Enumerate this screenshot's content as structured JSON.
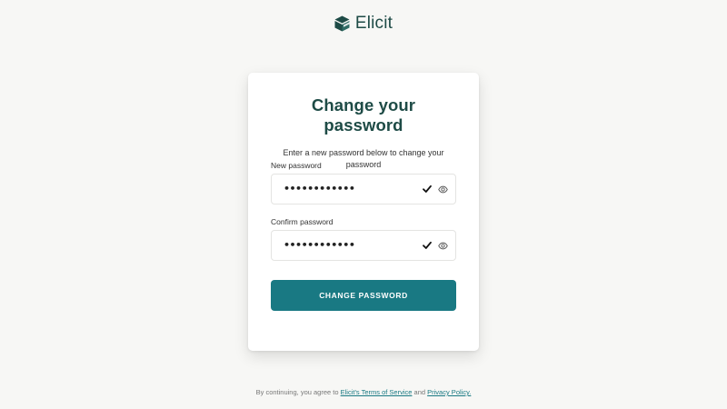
{
  "brand": {
    "name": "Elicit",
    "color": "#1e4b46",
    "logo_icon": "stacked-box-icon"
  },
  "card": {
    "title": "Change your password",
    "subtitle": "Enter a new password below to change your password",
    "new_password": {
      "label": "New password",
      "value": "••••••••••••",
      "valid_icon": "check-icon",
      "toggle_icon": "eye-icon"
    },
    "confirm_password": {
      "label": "Confirm password",
      "value": "••••••••••••",
      "valid_icon": "check-icon",
      "toggle_icon": "eye-icon"
    },
    "submit_label": "CHANGE PASSWORD",
    "accent_color": "#197983"
  },
  "footer": {
    "prefix": "By continuing, you agree to",
    "terms_link": "Elicit's Terms of Service",
    "conjunction": "and",
    "privacy_link": "Privacy Policy."
  }
}
